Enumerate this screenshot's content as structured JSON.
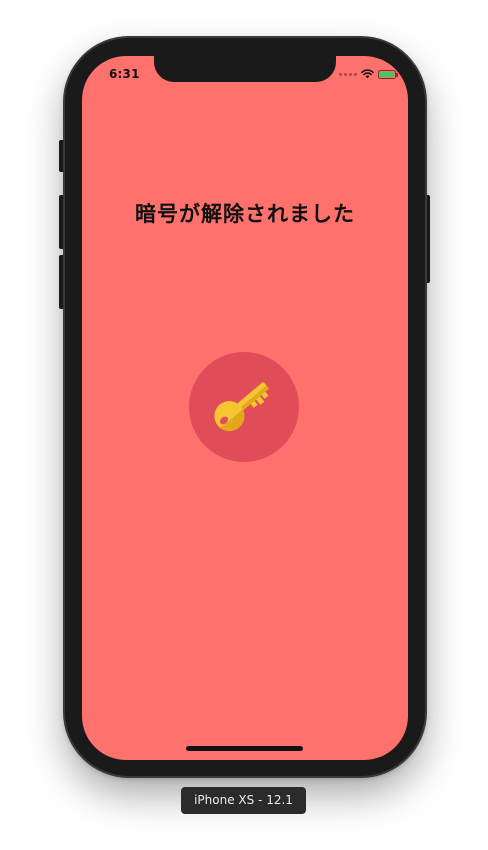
{
  "status_bar": {
    "time": "6:31",
    "signal_icon": "signal-dots-icon",
    "wifi_icon": "wifi-icon",
    "battery_icon": "battery-charging-icon"
  },
  "screen": {
    "background_color": "#ff716c",
    "title": "暗号が解除されました",
    "badge_color": "#e04d59",
    "key_icon": "key-icon",
    "key_color": "#f7c531"
  },
  "simulator": {
    "device_label": "iPhone XS - 12.1"
  }
}
